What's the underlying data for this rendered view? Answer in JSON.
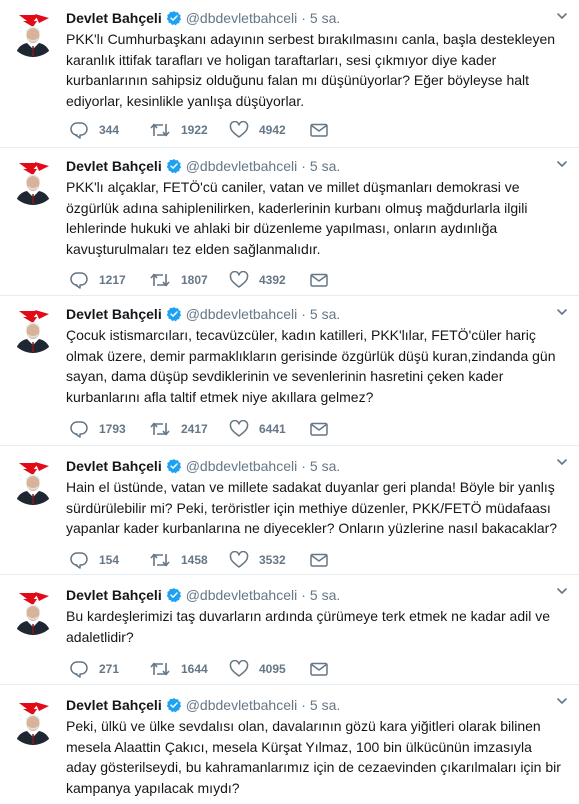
{
  "colors": {
    "verified": "#1da1f2",
    "muted": "#657786",
    "text": "#14171a",
    "divider": "#e6ecf0",
    "logo_red": "#e30a17"
  },
  "icons": {
    "reply": "reply-icon",
    "retweet": "retweet-icon",
    "like": "heart-icon",
    "dm": "envelope-icon",
    "verified": "verified-badge-icon",
    "menu": "chevron-down-icon"
  },
  "tweets": [
    {
      "name": "Devlet Bahçeli",
      "handle": "@dbdevletbahceli",
      "separator": "·",
      "time": "5 sa.",
      "text": "PKK'lı Cumhurbaşkanı adayının serbest bırakılmasını canla, başla destekleyen karanlık ittifak tarafları ve holigan taraftarları, sesi çıkmıyor diye kader kurbanlarının sahipsiz olduğunu falan mı düşünüyorlar? Eğer böyleyse halt ediyorlar, kesinlikle yanlışa düşüyorlar.",
      "replies": "344",
      "retweets": "1922",
      "likes": "4942"
    },
    {
      "name": "Devlet Bahçeli",
      "handle": "@dbdevletbahceli",
      "separator": "·",
      "time": "5 sa.",
      "text": "PKK'lı alçaklar, FETÖ'cü caniler, vatan ve millet düşmanları demokrasi ve özgürlük adına sahiplenilirken, kaderlerinin kurbanı olmuş mağdurlarla ilgili lehlerinde hukuki ve ahlaki bir düzenleme yapılması, onların aydınlığa kavuşturulmaları tez elden sağlanmalıdır.",
      "replies": "1217",
      "retweets": "1807",
      "likes": "4392"
    },
    {
      "name": "Devlet Bahçeli",
      "handle": "@dbdevletbahceli",
      "separator": "·",
      "time": "5 sa.",
      "text": "Çocuk istismarcıları, tecavüzcüler, kadın katilleri, PKK'lılar, FETÖ'cüler hariç olmak üzere, demir parmaklıkların gerisinde özgürlük düşü kuran,zindanda gün sayan, dama düşüp sevdiklerinin ve sevenlerinin hasretini çeken kader kurbanlarını afla taltif etmek niye akıllara gelmez?",
      "replies": "1793",
      "retweets": "2417",
      "likes": "6441"
    },
    {
      "name": "Devlet Bahçeli",
      "handle": "@dbdevletbahceli",
      "separator": "·",
      "time": "5 sa.",
      "text": "Hain el üstünde, vatan ve millete sadakat duyanlar geri planda! Böyle bir yanlış sürdürülebilir mi? Peki, teröristler için methiye düzenler, PKK/FETÖ müdafaası yapanlar kader kurbanlarına ne diyecekler? Onların yüzlerine nasıl bakacaklar?",
      "replies": "154",
      "retweets": "1458",
      "likes": "3532"
    },
    {
      "name": "Devlet Bahçeli",
      "handle": "@dbdevletbahceli",
      "separator": "·",
      "time": "5 sa.",
      "text": "Bu kardeşlerimizi taş duvarların ardında çürümeye terk etmek ne kadar adil ve adaletlidir?",
      "replies": "271",
      "retweets": "1644",
      "likes": "4095"
    },
    {
      "name": "Devlet Bahçeli",
      "handle": "@dbdevletbahceli",
      "separator": "·",
      "time": "5 sa.",
      "text": "Peki, ülkü ve ülke sevdalısı olan, davalarının gözü kara yiğitleri olarak bilinen mesela Alaattin Çakıcı, mesela Kürşat Yılmaz, 100 bin ülkücünün imzasıyla aday gösterilseydi, bu kahramanlarımız için de cezaevinden çıkarılmaları için bir kampanya yapılacak mıydı?"
    }
  ]
}
